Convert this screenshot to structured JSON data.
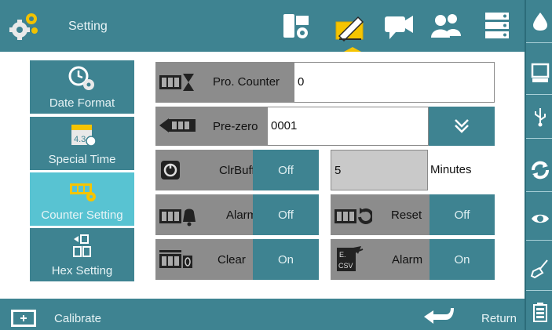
{
  "header": {
    "title": "Setting"
  },
  "top_nav": [
    {
      "icon": "device-settings-icon"
    },
    {
      "icon": "edit-message-icon",
      "active": true
    },
    {
      "icon": "camera-message-icon"
    },
    {
      "icon": "users-icon"
    },
    {
      "icon": "server-icon"
    }
  ],
  "right_rail": [
    {
      "icon": "ink-drop-icon"
    },
    {
      "icon": "printer-display-icon"
    },
    {
      "icon": "usb-icon"
    },
    {
      "icon": "refresh-icon"
    },
    {
      "icon": "eye-icon"
    },
    {
      "icon": "cleaning-brush-icon"
    },
    {
      "icon": "battery-icon"
    }
  ],
  "sidebar": {
    "items": [
      {
        "label": "Date Format",
        "icon": "clock-gear-icon"
      },
      {
        "label": "Special Time",
        "icon": "calendar-clock-icon"
      },
      {
        "label": "Counter Setting",
        "icon": "counter-gear-icon",
        "active": true
      },
      {
        "label": "Hex Setting",
        "icon": "hex-digits-icon"
      }
    ]
  },
  "main": {
    "pro_counter": {
      "label": "Pro. Counter",
      "value": "0"
    },
    "pre_zero": {
      "label": "Pre-zero",
      "value": "0001"
    },
    "clr_buff": {
      "label": "ClrBuff",
      "state": "Off"
    },
    "minutes": {
      "value": "5",
      "unit": "Minutes"
    },
    "alarm_left": {
      "label": "Alarm",
      "state": "Off"
    },
    "reset": {
      "label": "Reset",
      "state": "Off"
    },
    "clear": {
      "label": "Clear",
      "state": "On"
    },
    "alarm_right": {
      "label": "Alarm",
      "state": "On"
    }
  },
  "footer": {
    "calibrate_label": "Calibrate",
    "return_label": "Return"
  },
  "colors": {
    "teal": "#3e8391",
    "highlight": "#58c3d2",
    "grey": "#8c8c8c",
    "accent_yellow": "#f5c400"
  }
}
